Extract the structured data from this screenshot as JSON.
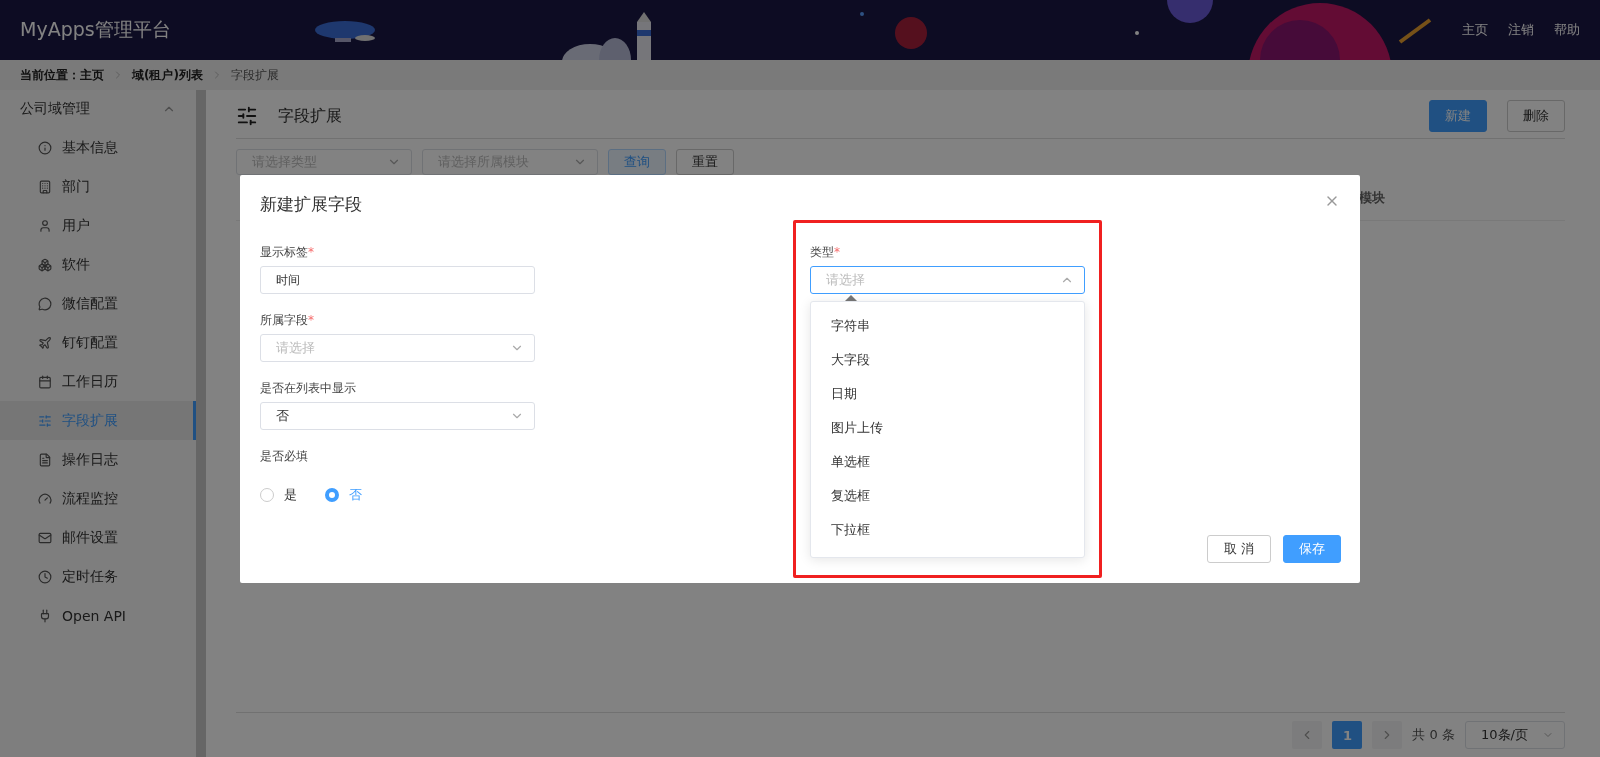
{
  "header": {
    "title": "MyApps管理平台",
    "links": [
      "主页",
      "注销",
      "帮助"
    ]
  },
  "breadcrumb": {
    "prefix": "当前位置：",
    "items": [
      {
        "label": "主页",
        "current": false
      },
      {
        "label": "域(租户)列表",
        "current": false
      },
      {
        "label": "字段扩展",
        "current": true
      }
    ]
  },
  "sidebar": {
    "group": {
      "label": "公司域管理",
      "expanded": true
    },
    "items": [
      {
        "label": "基本信息",
        "selected": false
      },
      {
        "label": "部门",
        "selected": false
      },
      {
        "label": "用户",
        "selected": false
      },
      {
        "label": "软件",
        "selected": false
      },
      {
        "label": "微信配置",
        "selected": false
      },
      {
        "label": "钉钉配置",
        "selected": false
      },
      {
        "label": "工作日历",
        "selected": false
      },
      {
        "label": "字段扩展",
        "selected": true
      },
      {
        "label": "操作日志",
        "selected": false
      },
      {
        "label": "流程监控",
        "selected": false
      },
      {
        "label": "邮件设置",
        "selected": false
      },
      {
        "label": "定时任务",
        "selected": false
      },
      {
        "label": "Open API",
        "selected": false
      }
    ]
  },
  "page": {
    "title": "字段扩展",
    "buttons": [
      {
        "label": "新建",
        "kind": "primary"
      },
      {
        "label": "删除",
        "kind": "default"
      }
    ],
    "filters": [
      {
        "placeholder": "请选择类型"
      },
      {
        "placeholder": "请选择所属模块"
      }
    ],
    "filter_buttons": [
      {
        "label": "查询",
        "kind": "primary"
      },
      {
        "label": "重置",
        "kind": "default"
      }
    ],
    "table": {
      "columns": [
        "模块"
      ]
    },
    "pagination": {
      "pages": [
        {
          "label": "1",
          "selected": true
        }
      ],
      "total": "共 0 条",
      "page_size": "10条/页"
    }
  },
  "dialog": {
    "title": "新建扩展字段",
    "required_mark": "*",
    "left_fields": [
      {
        "kind": "input",
        "label": "显示标签",
        "required": true,
        "value": "时间"
      },
      {
        "kind": "select",
        "label": "所属字段",
        "required": true,
        "placeholder": "请选择"
      },
      {
        "kind": "select",
        "label": "是否在列表中显示",
        "required": false,
        "value": "否"
      },
      {
        "kind": "radio",
        "label": "是否必填",
        "required": false,
        "options": [
          {
            "label": "是",
            "selected": false
          },
          {
            "label": "否",
            "selected": true
          }
        ]
      }
    ],
    "right_fields": [
      {
        "kind": "select",
        "label": "类型",
        "required": true,
        "placeholder": "请选择",
        "open": true,
        "options": [
          "字符串",
          "大字段",
          "日期",
          "图片上传",
          "单选框",
          "复选框",
          "下拉框"
        ]
      }
    ],
    "buttons": [
      {
        "label": "取 消",
        "kind": "default"
      },
      {
        "label": "保存",
        "kind": "primary"
      }
    ]
  }
}
